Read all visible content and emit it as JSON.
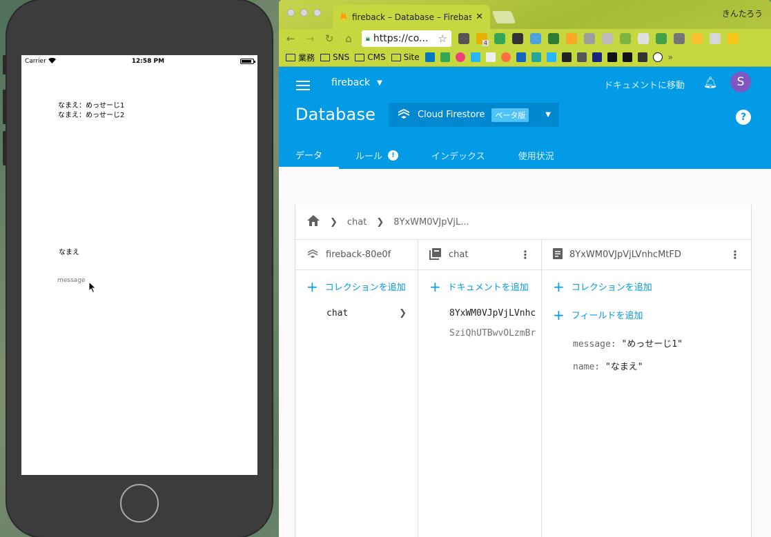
{
  "simulator": {
    "carrier": "Carrier",
    "time": "12:58 PM",
    "messages": [
      "なまえ：めっせーじ1",
      "なまえ：めっせーじ2"
    ],
    "name_value": "なまえ",
    "message_placeholder": "message"
  },
  "browser": {
    "tab_title": "fireback – Database – Firebase",
    "profile_name": "きんたろう",
    "url": "https://co...",
    "bookmarks": [
      "業務",
      "SNS",
      "CMS",
      "Site"
    ],
    "extension_badge": "4"
  },
  "firebase": {
    "project": "fireback",
    "goto_docs": "ドキュメントに移動",
    "avatar_letter": "S",
    "page_title": "Database",
    "db_product": "Cloud Firestore",
    "beta_label": "ベータ版",
    "tabs": [
      {
        "label": "データ",
        "active": true
      },
      {
        "label": "ルール",
        "alert": "!"
      },
      {
        "label": "インデックス"
      },
      {
        "label": "使用状況"
      }
    ],
    "breadcrumb": [
      "chat",
      "8YxWM0VJpVjL..."
    ],
    "columns": {
      "root": {
        "title": "fireback-80e0f",
        "add_label": "コレクションを追加",
        "items": [
          "chat"
        ]
      },
      "collection": {
        "title": "chat",
        "add_label": "ドキュメントを追加",
        "items": [
          "8YxWM0VJpVjLVnhc",
          "SziQhUTBwvOLzmBr"
        ]
      },
      "document": {
        "title": "8YxWM0VJpVjLVnhcMtFD",
        "add_collection_label": "コレクションを追加",
        "add_field_label": "フィールドを追加",
        "fields": [
          {
            "key": "message:",
            "value": "\"めっせーじ1\""
          },
          {
            "key": "name:",
            "value": "\"なまえ\""
          }
        ]
      }
    }
  },
  "colors": {
    "firebase_blue": "#039be5",
    "chrome_theme": "#c5d83f",
    "avatar": "#7e57c2"
  }
}
